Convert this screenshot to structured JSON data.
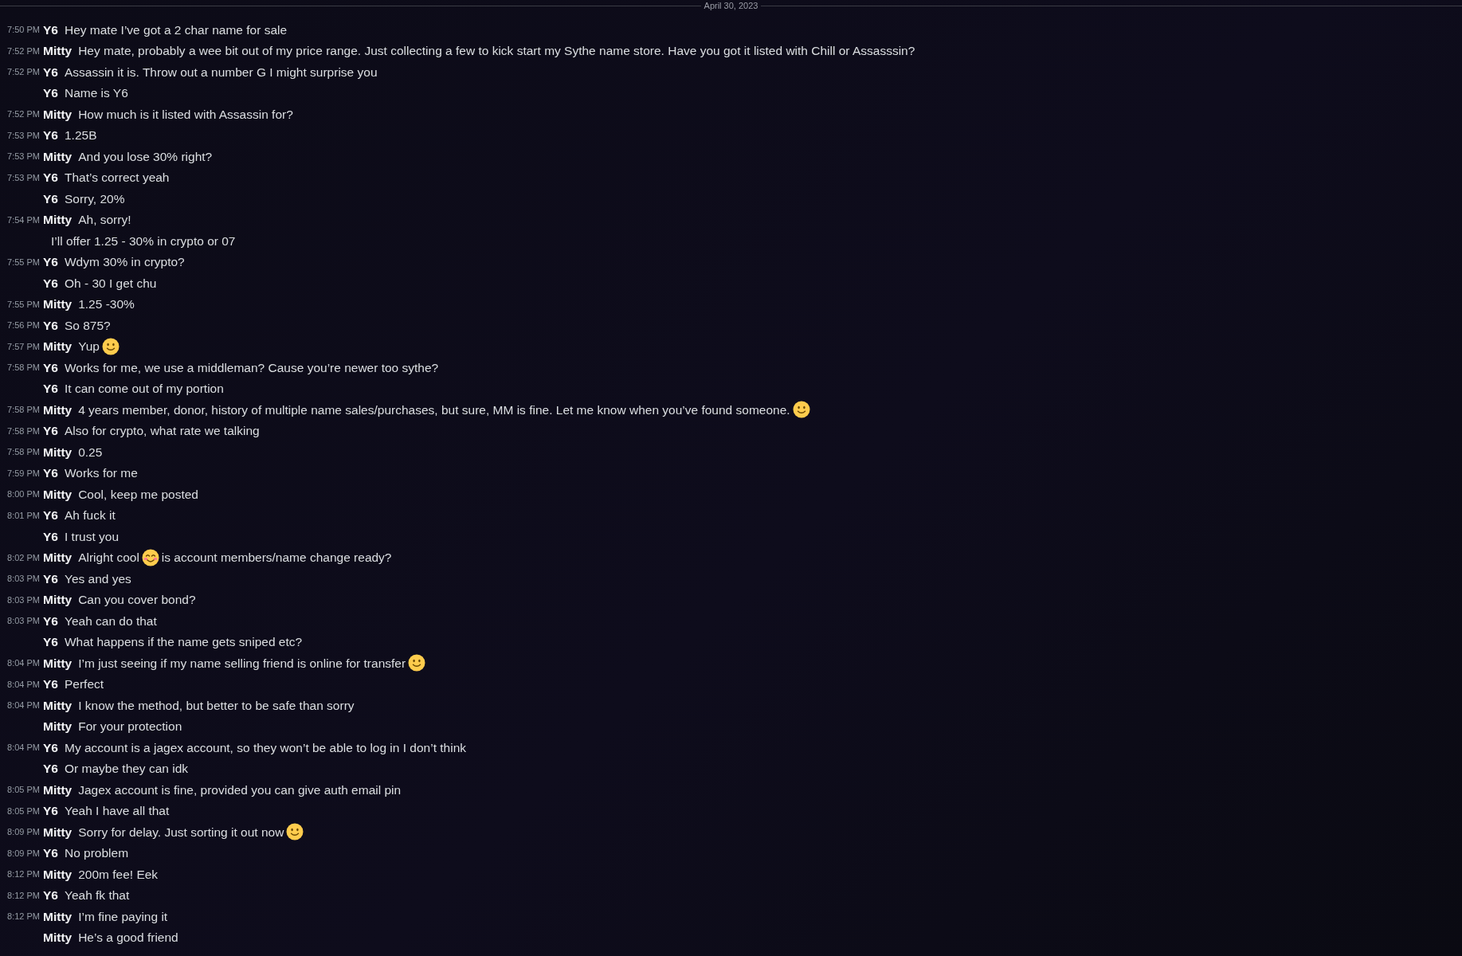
{
  "date_divider": "April 30, 2023",
  "messages": [
    {
      "time": "7:50 PM",
      "author": "Y6",
      "parts": [
        {
          "kind": "text",
          "text": "Hey mate I’ve got a 2 char name for sale"
        }
      ]
    },
    {
      "time": "7:52 PM",
      "author": "Mitty",
      "parts": [
        {
          "kind": "text",
          "text": "Hey mate, probably a wee bit out of my price range. Just collecting a few to kick start my Sythe name store. Have you got it listed with Chill or Assasssin?"
        }
      ]
    },
    {
      "time": "7:52 PM",
      "author": "Y6",
      "parts": [
        {
          "kind": "text",
          "text": "Assassin it is. Throw out a number G I might surprise you"
        }
      ]
    },
    {
      "author": "Y6",
      "parts": [
        {
          "kind": "text",
          "text": "Name is Y6"
        }
      ]
    },
    {
      "time": "7:52 PM",
      "author": "Mitty",
      "parts": [
        {
          "kind": "text",
          "text": "How much is it listed with Assassin for?"
        }
      ]
    },
    {
      "time": "7:53 PM",
      "author": "Y6",
      "parts": [
        {
          "kind": "text",
          "text": "1.25B"
        }
      ]
    },
    {
      "time": "7:53 PM",
      "author": "Mitty",
      "parts": [
        {
          "kind": "text",
          "text": "And you lose 30% right?"
        }
      ]
    },
    {
      "time": "7:53 PM",
      "author": "Y6",
      "parts": [
        {
          "kind": "text",
          "text": "That’s correct yeah"
        }
      ]
    },
    {
      "author": "Y6",
      "parts": [
        {
          "kind": "text",
          "text": "Sorry, 20%"
        }
      ]
    },
    {
      "time": "7:54 PM",
      "author": "Mitty",
      "parts": [
        {
          "kind": "text",
          "text": "Ah, sorry!"
        }
      ]
    },
    {
      "parts": [
        {
          "kind": "text",
          "text": "I’ll offer 1.25 - 30% in crypto or 07"
        }
      ]
    },
    {
      "time": "7:55 PM",
      "author": "Y6",
      "parts": [
        {
          "kind": "text",
          "text": "Wdym 30% in crypto?"
        }
      ]
    },
    {
      "author": "Y6",
      "parts": [
        {
          "kind": "text",
          "text": "Oh - 30 I get chu"
        }
      ]
    },
    {
      "time": "7:55 PM",
      "author": "Mitty",
      "parts": [
        {
          "kind": "text",
          "text": "1.25 -30%"
        }
      ]
    },
    {
      "time": "7:56 PM",
      "author": "Y6",
      "parts": [
        {
          "kind": "text",
          "text": "So 875?"
        }
      ]
    },
    {
      "time": "7:57 PM",
      "author": "Mitty",
      "parts": [
        {
          "kind": "text",
          "text": "Yup"
        },
        {
          "kind": "smile"
        }
      ]
    },
    {
      "time": "7:58 PM",
      "author": "Y6",
      "parts": [
        {
          "kind": "text",
          "text": "Works for me, we use a middleman? Cause you’re newer too sythe?"
        }
      ]
    },
    {
      "author": "Y6",
      "parts": [
        {
          "kind": "text",
          "text": "It can come out of my portion"
        }
      ]
    },
    {
      "time": "7:58 PM",
      "author": "Mitty",
      "parts": [
        {
          "kind": "text",
          "text": "4 years member, donor, history of multiple name sales/purchases, but sure, MM is fine. Let me know when you’ve found someone."
        },
        {
          "kind": "smile"
        }
      ]
    },
    {
      "time": "7:58 PM",
      "author": "Y6",
      "parts": [
        {
          "kind": "text",
          "text": "Also for crypto, what rate we talking"
        }
      ]
    },
    {
      "time": "7:58 PM",
      "author": "Mitty",
      "parts": [
        {
          "kind": "text",
          "text": "0.25"
        }
      ]
    },
    {
      "time": "7:59 PM",
      "author": "Y6",
      "parts": [
        {
          "kind": "text",
          "text": "Works for me"
        }
      ]
    },
    {
      "time": "8:00 PM",
      "author": "Mitty",
      "parts": [
        {
          "kind": "text",
          "text": "Cool, keep me posted"
        }
      ]
    },
    {
      "time": "8:01 PM",
      "author": "Y6",
      "parts": [
        {
          "kind": "text",
          "text": "Ah fuck it"
        }
      ]
    },
    {
      "author": "Y6",
      "parts": [
        {
          "kind": "text",
          "text": "I trust you"
        }
      ]
    },
    {
      "time": "8:02 PM",
      "author": "Mitty",
      "parts": [
        {
          "kind": "text",
          "text": "Alright cool"
        },
        {
          "kind": "blush"
        },
        {
          "kind": "text",
          "text": "is account members/name change ready?"
        }
      ]
    },
    {
      "time": "8:03 PM",
      "author": "Y6",
      "parts": [
        {
          "kind": "text",
          "text": "Yes and yes"
        }
      ]
    },
    {
      "time": "8:03 PM",
      "author": "Mitty",
      "parts": [
        {
          "kind": "text",
          "text": "Can you cover bond?"
        }
      ]
    },
    {
      "time": "8:03 PM",
      "author": "Y6",
      "parts": [
        {
          "kind": "text",
          "text": "Yeah can do that"
        }
      ]
    },
    {
      "author": "Y6",
      "parts": [
        {
          "kind": "text",
          "text": "What happens if the name gets sniped etc?"
        }
      ]
    },
    {
      "time": "8:04 PM",
      "author": "Mitty",
      "parts": [
        {
          "kind": "text",
          "text": "I’m just seeing if my name selling friend is online for transfer"
        },
        {
          "kind": "smile"
        }
      ]
    },
    {
      "time": "8:04 PM",
      "author": "Y6",
      "parts": [
        {
          "kind": "text",
          "text": "Perfect"
        }
      ]
    },
    {
      "time": "8:04 PM",
      "author": "Mitty",
      "parts": [
        {
          "kind": "text",
          "text": "I know the method, but better to be safe than sorry"
        }
      ]
    },
    {
      "author": "Mitty",
      "parts": [
        {
          "kind": "text",
          "text": "For your protection"
        }
      ]
    },
    {
      "time": "8:04 PM",
      "author": "Y6",
      "parts": [
        {
          "kind": "text",
          "text": "My account is a jagex account, so they won’t be able to log in I don’t think"
        }
      ]
    },
    {
      "author": "Y6",
      "parts": [
        {
          "kind": "text",
          "text": "Or maybe they can idk"
        }
      ]
    },
    {
      "time": "8:05 PM",
      "author": "Mitty",
      "parts": [
        {
          "kind": "text",
          "text": "Jagex account is fine, provided you can give auth email pin"
        }
      ]
    },
    {
      "time": "8:05 PM",
      "author": "Y6",
      "parts": [
        {
          "kind": "text",
          "text": "Yeah I have all that"
        }
      ]
    },
    {
      "time": "8:09 PM",
      "author": "Mitty",
      "parts": [
        {
          "kind": "text",
          "text": "Sorry for delay. Just sorting it out now"
        },
        {
          "kind": "smile"
        }
      ]
    },
    {
      "time": "8:09 PM",
      "author": "Y6",
      "parts": [
        {
          "kind": "text",
          "text": "No problem"
        }
      ]
    },
    {
      "time": "8:12 PM",
      "author": "Mitty",
      "parts": [
        {
          "kind": "text",
          "text": "200m fee! Eek"
        }
      ]
    },
    {
      "time": "8:12 PM",
      "author": "Y6",
      "parts": [
        {
          "kind": "text",
          "text": "Yeah fk that"
        }
      ]
    },
    {
      "time": "8:12 PM",
      "author": "Mitty",
      "parts": [
        {
          "kind": "text",
          "text": "I’m fine paying it"
        }
      ]
    },
    {
      "author": "Mitty",
      "parts": [
        {
          "kind": "text",
          "text": "He’s a good friend"
        }
      ]
    }
  ]
}
